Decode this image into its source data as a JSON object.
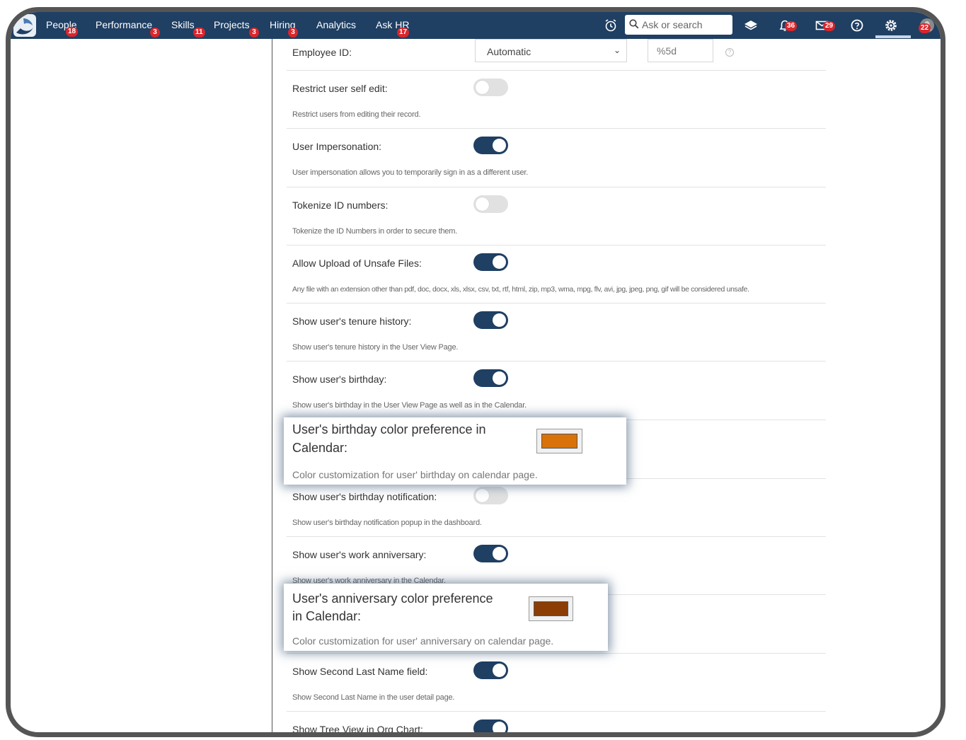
{
  "nav": {
    "items": [
      {
        "label": "People",
        "badge": "18"
      },
      {
        "label": "Performance",
        "badge": "3"
      },
      {
        "label": "Skills",
        "badge": "11"
      },
      {
        "label": "Projects",
        "badge": "3"
      },
      {
        "label": "Hiring",
        "badge": "3"
      },
      {
        "label": "Analytics",
        "badge": ""
      },
      {
        "label": "Ask HR",
        "badge": "17"
      }
    ],
    "search_placeholder": "Ask or search",
    "notifications_badge": "36",
    "messages_badge": "29",
    "avatar_badge": "22"
  },
  "settings": {
    "employee_id": {
      "label": "Employee ID:",
      "select_value": "Automatic",
      "format_value": "%5d"
    },
    "rows": [
      {
        "label": "Restrict user self edit:",
        "on": false,
        "desc": "Restrict users from editing their record."
      },
      {
        "label": "User Impersonation:",
        "on": true,
        "desc": "User impersonation allows you to temporarily sign in as a different user."
      },
      {
        "label": "Tokenize ID numbers:",
        "on": false,
        "desc": "Tokenize the ID Numbers in order to secure them."
      },
      {
        "label": "Allow Upload of Unsafe Files:",
        "on": true,
        "desc": "Any file with an extension other than pdf, doc, docx, xls, xlsx, csv, txt, rtf, html, zip, mp3, wma, mpg, flv, avi, jpg, jpeg, png, gif will be considered unsafe."
      },
      {
        "label": "Show user's tenure history:",
        "on": true,
        "desc": "Show user's tenure history in the User View Page."
      },
      {
        "label": "Show user's birthday:",
        "on": true,
        "desc": "Show user's birthday in the User View Page as well as in the Calendar."
      },
      {
        "label": "Show user's birthday notification:",
        "on": false,
        "desc": "Show user's birthday notification popup in the dashboard."
      },
      {
        "label": "Show user's work anniversary:",
        "on": true,
        "desc": "Show user's work anniversary in the Calendar."
      },
      {
        "label": "Show Second Last Name field:",
        "on": true,
        "desc": "Show Second Last Name in the user detail page."
      },
      {
        "label": "Show Tree View in Org Chart:",
        "on": true,
        "desc": ""
      }
    ],
    "birthday_color": {
      "title_line1": "User's birthday color preference in",
      "title_line2": "Calendar:",
      "desc": "Color customization for user' birthday on calendar page.",
      "color": "#d97208"
    },
    "anniversary_color": {
      "title_line1": "User's anniversary color preference",
      "title_line2": "in Calendar:",
      "desc": "Color customization for user' anniversary on calendar page.",
      "color": "#8b3d05"
    }
  },
  "colors": {
    "navbar": "#1f3f63",
    "toggle_on": "#1f3f63",
    "toggle_off": "#e1e1e1",
    "badge": "#d9262c"
  }
}
